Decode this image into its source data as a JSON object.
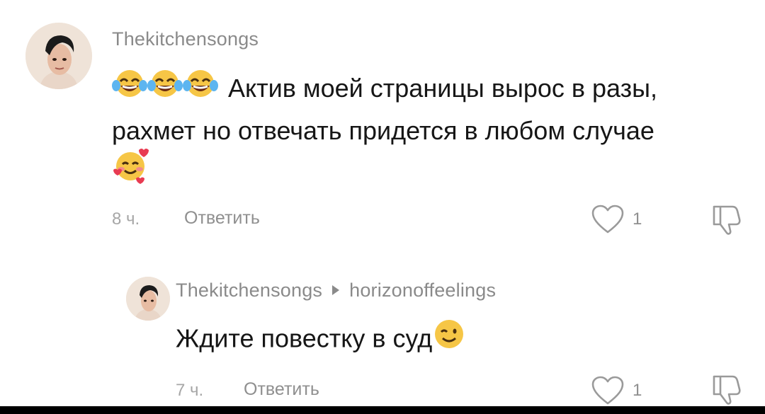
{
  "comment": {
    "username": "Thekitchensongs",
    "line1": "Актив моей страницы вырос в разы,",
    "line2": "рахмет но отвечать придется в любом случае",
    "time": "8 ч.",
    "reply_label": "Ответить",
    "like_count": "1",
    "emojis": [
      "tears-of-joy-emoji",
      "tears-of-joy-emoji",
      "tears-of-joy-emoji",
      "smiling-face-with-hearts-emoji"
    ]
  },
  "reply": {
    "username": "Thekitchensongs",
    "reply_to": "horizonoffeelings",
    "text": "Ждите повестку в суд",
    "time": "7 ч.",
    "reply_label": "Ответить",
    "like_count": "1",
    "emojis": [
      "winking-face-emoji"
    ]
  }
}
